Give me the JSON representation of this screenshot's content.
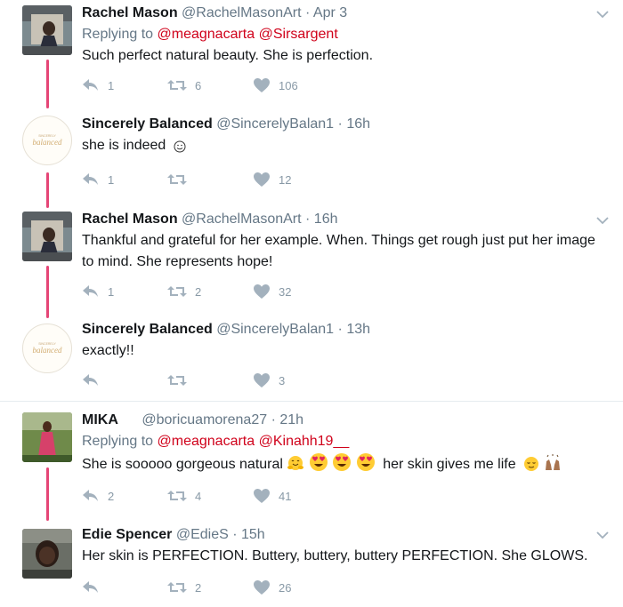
{
  "colors": {
    "accent": "#e0245e",
    "mention": "#d0021b",
    "muted": "#657786",
    "icon": "#a3b1bd"
  },
  "tweets": [
    {
      "name": "Rachel Mason",
      "handle": "@RachelMasonArt",
      "sep": "·",
      "time": "Apr 3",
      "reply_prefix": "Replying to",
      "mentions": [
        "@meagnacarta",
        "@Sirsargent"
      ],
      "text": "Such perfect natural beauty. She is perfection.",
      "counts": {
        "replies": "1",
        "retweets": "6",
        "likes": "106"
      }
    },
    {
      "name": "Sincerely Balanced",
      "handle": "@SincerelyBalan1",
      "sep": "·",
      "time": "16h",
      "text": "she is indeed",
      "counts": {
        "replies": "1",
        "retweets": "",
        "likes": "12"
      },
      "avatar_text": "balanced"
    },
    {
      "name": "Rachel Mason",
      "handle": "@RachelMasonArt",
      "sep": "·",
      "time": "16h",
      "text": "Thankful and grateful for her example. When. Things get rough just put her image to mind. She represents hope!",
      "counts": {
        "replies": "1",
        "retweets": "2",
        "likes": "32"
      }
    },
    {
      "name": "Sincerely Balanced",
      "handle": "@SincerelyBalan1",
      "sep": "·",
      "time": "13h",
      "text": "exactly!!",
      "counts": {
        "replies": "",
        "retweets": "",
        "likes": "3"
      },
      "avatar_text": "balanced"
    },
    {
      "name": "MIKA",
      "handle": "@boricuamorena27",
      "sep": "·",
      "time": "21h",
      "reply_prefix": "Replying to",
      "mentions": [
        "@meagnacarta",
        "@Kinahh19__"
      ],
      "text_a": "She is sooooo gorgeous natural",
      "text_b": "her skin gives me life",
      "counts": {
        "replies": "2",
        "retweets": "4",
        "likes": "41"
      }
    },
    {
      "name": "Edie Spencer",
      "handle": "@EdieS",
      "sep": "·",
      "time": "15h",
      "text": "Her skin is PERFECTION. Buttery, buttery, buttery PERFECTION. She GLOWS.",
      "counts": {
        "replies": "",
        "retweets": "2",
        "likes": "26"
      }
    }
  ]
}
